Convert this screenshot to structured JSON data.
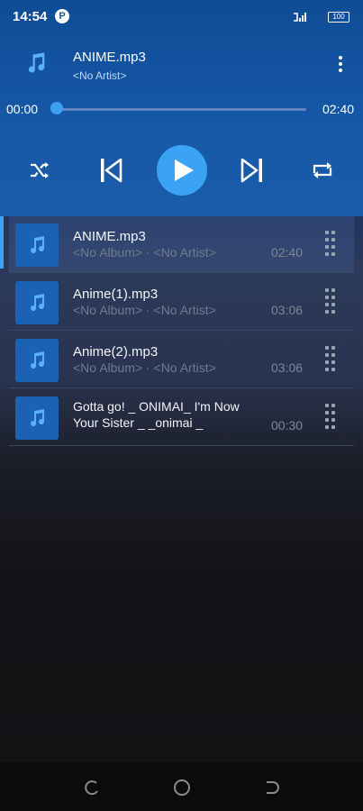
{
  "status": {
    "time": "14:54",
    "p_badge": "P",
    "battery": "100"
  },
  "now_playing": {
    "title": "ANIME.mp3",
    "artist": "<No Artist>",
    "current_time": "00:00",
    "total_time": "02:40",
    "progress": 0
  },
  "controls": {
    "shuffle_icon": "shuffle-icon",
    "prev_icon": "skip-previous-icon",
    "play_icon": "play-icon",
    "next_icon": "skip-next-icon",
    "repeat_icon": "repeat-icon",
    "accent_color": "#3aa3f5"
  },
  "playlist": [
    {
      "title": "ANIME.mp3",
      "album": "<No Album>",
      "artist": "<No Artist>",
      "duration": "02:40",
      "active": true
    },
    {
      "title": "Anime(1).mp3",
      "album": "<No Album>",
      "artist": "<No Artist>",
      "duration": "03:06",
      "active": false
    },
    {
      "title": "Anime(2).mp3",
      "album": "<No Album>",
      "artist": "<No Artist>",
      "duration": "03:06",
      "active": false
    },
    {
      "title": "Gotta go! _ ONIMAI_ I'm Now Your Sister _ _onimai _",
      "duration": "00:30",
      "active": false
    }
  ],
  "separator": " · ",
  "navbar": {
    "icons": [
      "recents-icon",
      "home-icon",
      "back-icon"
    ]
  }
}
